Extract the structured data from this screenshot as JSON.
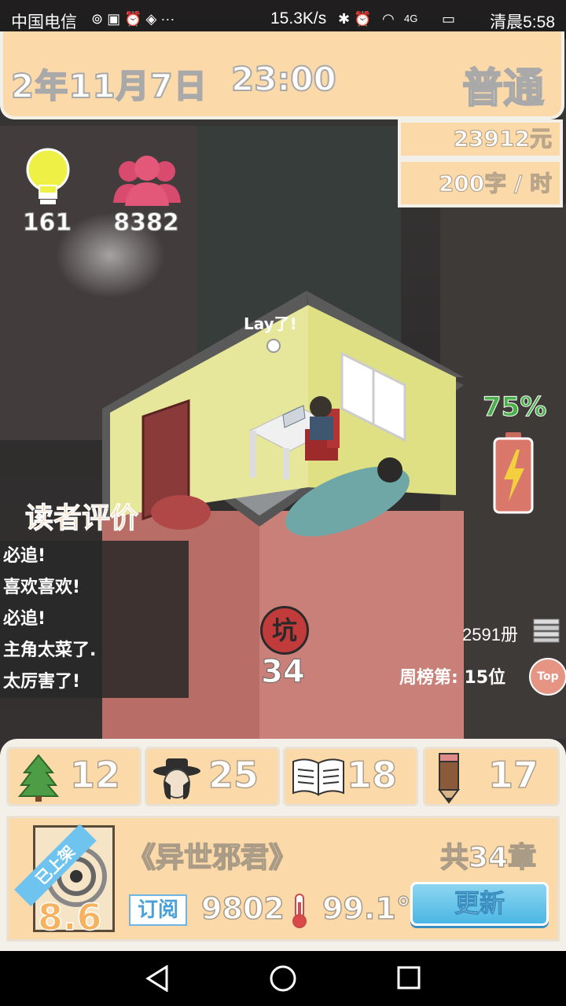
{
  "status_bar": {
    "carrier": "中国电信",
    "speed": "15.3K/s",
    "network": "4G",
    "time": "清晨5:58"
  },
  "header": {
    "date": "2年11月7日",
    "time": "23:00",
    "difficulty": "普通",
    "money": "23912元",
    "speed": "200字 / 时"
  },
  "stats": {
    "inspiration": "161",
    "fans": "8382"
  },
  "room": {
    "speech": "Lay了!"
  },
  "reviews": {
    "title": "读者评价",
    "items": [
      "必追!",
      "喜欢喜欢!",
      "必追!",
      "主角太菜了.",
      "太厉害了!"
    ]
  },
  "pit": {
    "label": "坑",
    "count": "34"
  },
  "battery": {
    "percent_text": "75%",
    "level": 0.75,
    "color": "#4bb04b"
  },
  "ranking": {
    "books": "2591册",
    "weekly": "周榜第: 15位",
    "top_button": "Top"
  },
  "resources": [
    {
      "icon": "tree-icon",
      "value": "12"
    },
    {
      "icon": "character-icon",
      "value": "25"
    },
    {
      "icon": "book-icon",
      "value": "18"
    },
    {
      "icon": "pencil-icon",
      "value": "17"
    }
  ],
  "book": {
    "ribbon": "已上架",
    "score": "8.6",
    "title": "《异世邪君》",
    "chapters": "共34章",
    "subscribe_label": "订阅",
    "subscribers": "9802",
    "heat": "99.1°",
    "update_button": "更新"
  }
}
